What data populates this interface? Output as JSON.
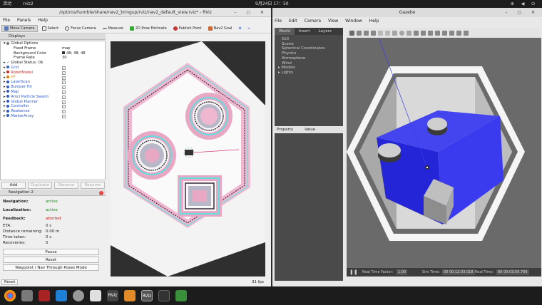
{
  "topbar": {
    "activities": "活动",
    "app": "rviz2",
    "clock": "9月24日  17：50",
    "tray": "⊕ ◀ ⏻"
  },
  "rviz": {
    "title": "/opt/ros/humble/share/nav2_bringup/rviz/nav2_default_view.rviz* - RViz",
    "menu": [
      "File",
      "Panels",
      "Help"
    ],
    "tools": [
      "Move Camera",
      "Select",
      "Focus Camera",
      "Measure",
      "2D Pose Estimate",
      "Publish Point",
      "Nav2 Goal"
    ],
    "displays_title": "Displays",
    "global_options": "Global Options",
    "options": [
      {
        "label": "Fixed Frame",
        "value": "map"
      },
      {
        "label": "Background Color",
        "value": "48; 48; 48"
      },
      {
        "label": "Frame Rate",
        "value": "30"
      }
    ],
    "global_status": "Global Status: Ok",
    "displays": [
      "Grid",
      "RobotModel",
      "TF",
      "LaserScan",
      "Bumper Hit",
      "Map",
      "Amcl Particle Swarm",
      "Global Planner",
      "Controller",
      "Realsense",
      "MarkerArray"
    ],
    "display_colors": [
      "#3a5fcd",
      "#d02525",
      "#e07b00",
      "#2a57c9",
      "#2a57c9",
      "#2a57c9",
      "#2a57c9",
      "#2a57c9",
      "#2a57c9",
      "#2a57c9",
      "#2a57c9"
    ],
    "buttons": {
      "add": "Add",
      "duplicate": "Duplicate",
      "remove": "Remove",
      "rename": "Rename"
    },
    "nav_title": "Navigation 2",
    "navigation_label": "Navigation:",
    "navigation_value": "active",
    "localization_label": "Localization:",
    "localization_value": "active",
    "feedback_label": "Feedback:",
    "feedback_value": "aborted",
    "eta_label": "ETA:",
    "eta_value": "0 s",
    "dist_label": "Distance remaining:",
    "dist_value": "0.00 m",
    "time_label": "Time taken:",
    "time_value": "0 s",
    "rec_label": "Recoveries:",
    "rec_value": "0",
    "pause": "Pause",
    "reset_btn": "Reset",
    "waypoint": "Waypoint / Nav Through Poses Mode",
    "reset": "Reset",
    "fps": "31 fps"
  },
  "gazebo": {
    "title": "Gazebo",
    "menu": [
      "File",
      "Edit",
      "Camera",
      "View",
      "Window",
      "Help"
    ],
    "tabs": [
      "World",
      "Insert",
      "Layers"
    ],
    "world_items": [
      "GUI",
      "Scene",
      "Spherical Coordinates",
      "Physics",
      "Atmosphere",
      "Wind",
      "Models",
      "Lights"
    ],
    "prop_col": "Property",
    "val_col": "Value",
    "rtf_label": "Real Time Factor:",
    "rtf": "1.00",
    "sim_label": "Sim Time:",
    "sim": "00 00:12:03.018",
    "real_label": "Real Time:",
    "real": "00 00:03:56.706"
  }
}
